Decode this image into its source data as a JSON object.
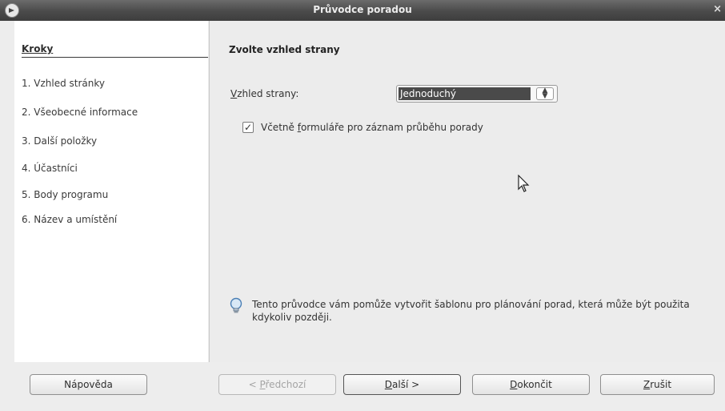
{
  "window": {
    "title": "Průvodce poradou",
    "close_symbol": "×"
  },
  "steps_panel": {
    "heading": "Kroky",
    "items": [
      {
        "label": "1. Vzhled stránky"
      },
      {
        "label": "2. Všeobecné informace"
      },
      {
        "label": "3. Další položky"
      },
      {
        "label": "4. Účastníci"
      },
      {
        "label": "5. Body programu"
      },
      {
        "label": "6. Název a umístění"
      }
    ]
  },
  "main": {
    "heading": "Zvolte vzhled strany",
    "layout": {
      "label_mnemonic": "V",
      "label_rest": "zhled strany:",
      "selected": "Jednoduchý"
    },
    "include_form": {
      "checked": true,
      "label_before": "Včetně ",
      "label_mnemonic": "f",
      "label_after": "ormuláře pro záznam průběhu porady"
    },
    "info_text": "Tento průvodce vám pomůže vytvořit šablonu pro plánování porad, která může být použita kdykoliv později.",
    "icons": {
      "info": "lightbulb-icon",
      "cursor": "mouse-pointer-icon"
    }
  },
  "footer": {
    "help": "Nápověda",
    "previous": {
      "prefix": "< ",
      "mnemonic": "P",
      "rest": "ředchozí"
    },
    "next": {
      "mnemonic": "D",
      "rest": "alší >"
    },
    "finish": {
      "mnemonic": "D",
      "rest": "okončit"
    },
    "cancel": {
      "mnemonic": "Z",
      "rest": "rušit"
    }
  }
}
